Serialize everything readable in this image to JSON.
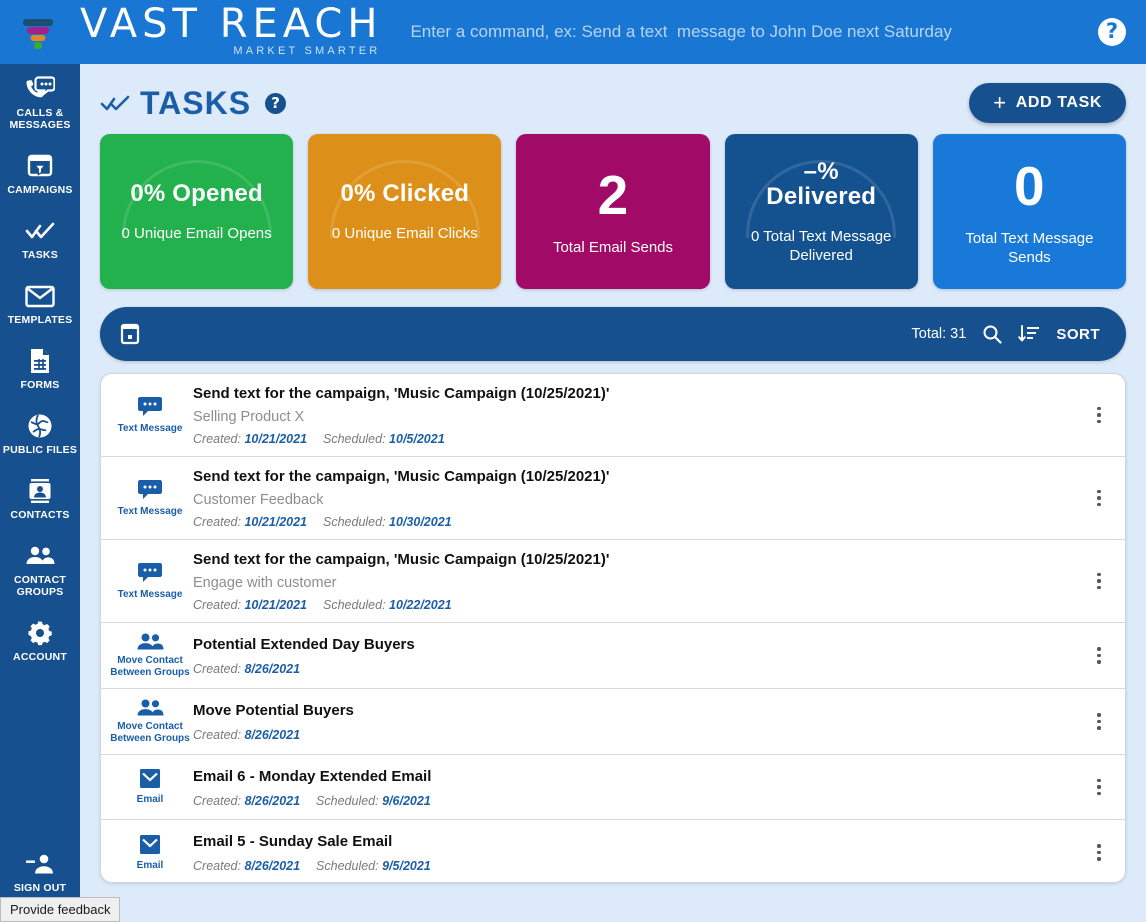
{
  "header": {
    "brand_name": "VAST REACH",
    "brand_tagline": "MARKET SMARTER",
    "command_placeholder": "Enter a command, ex: Send a text  message to John Doe next Saturday",
    "command_value": "",
    "help_glyph": "?"
  },
  "sidebar": {
    "items": [
      {
        "icon": "calls-messages-icon",
        "label": "CALLS &\nMESSAGES"
      },
      {
        "icon": "campaigns-icon",
        "label": "CAMPAIGNS"
      },
      {
        "icon": "tasks-icon",
        "label": "TASKS"
      },
      {
        "icon": "templates-icon",
        "label": "TEMPLATES"
      },
      {
        "icon": "forms-icon",
        "label": "FORMS"
      },
      {
        "icon": "public-files-icon",
        "label": "PUBLIC\nFILES"
      },
      {
        "icon": "contacts-icon",
        "label": "CONTACTS"
      },
      {
        "icon": "contact-groups-icon",
        "label": "CONTACT\nGROUPS"
      },
      {
        "icon": "account-icon",
        "label": "ACCOUNT"
      }
    ],
    "signout": {
      "icon": "sign-out-icon",
      "label": "SIGN OUT"
    }
  },
  "page": {
    "title": "TASKS",
    "help_glyph": "?",
    "add_task_label": "ADD TASK",
    "add_task_plus": "+"
  },
  "cards": [
    {
      "main": "0% Opened",
      "sub": "0 Unique Email Opens",
      "color": "#22b14c",
      "gauge": true,
      "big": false
    },
    {
      "main": "0% Clicked",
      "sub": "0 Unique Email Clicks",
      "color": "#dd9019",
      "gauge": true,
      "big": false
    },
    {
      "main": "2",
      "sub": "Total Email Sends",
      "color": "#a10a66",
      "gauge": false,
      "big": true
    },
    {
      "main": "–%\nDelivered",
      "sub": "0 Total Text Message Delivered",
      "color": "#13518f",
      "gauge": true,
      "big": false
    },
    {
      "main": "0",
      "sub": "Total Text Message Sends",
      "color": "#1879d8",
      "gauge": false,
      "big": true
    }
  ],
  "filterbar": {
    "calendar_icon": "calendar-icon",
    "total_label": "Total: 31",
    "search_icon": "search-icon",
    "sort_icon": "sort-descending-icon",
    "sort_label": "SORT"
  },
  "tasks": [
    {
      "type_icon": "text-message-icon",
      "type_label": "Text Message",
      "title": "Send text for the campaign, 'Music Campaign (10/25/2021)'",
      "desc": "Selling Product X",
      "created_label": "Created:",
      "created_value": "10/21/2021",
      "scheduled_label": "Scheduled:",
      "scheduled_value": "10/5/2021"
    },
    {
      "type_icon": "text-message-icon",
      "type_label": "Text Message",
      "title": "Send text for the campaign, 'Music Campaign (10/25/2021)'",
      "desc": "Customer Feedback",
      "created_label": "Created:",
      "created_value": "10/21/2021",
      "scheduled_label": "Scheduled:",
      "scheduled_value": "10/30/2021"
    },
    {
      "type_icon": "text-message-icon",
      "type_label": "Text Message",
      "title": "Send text for the campaign, 'Music Campaign (10/25/2021)'",
      "desc": "Engage with customer",
      "created_label": "Created:",
      "created_value": "10/21/2021",
      "scheduled_label": "Scheduled:",
      "scheduled_value": "10/22/2021"
    },
    {
      "type_icon": "move-contact-icon",
      "type_label": "Move Contact\nBetween Groups",
      "title": "Potential Extended Day Buyers",
      "desc": "",
      "created_label": "Created:",
      "created_value": "8/26/2021",
      "scheduled_label": "",
      "scheduled_value": ""
    },
    {
      "type_icon": "move-contact-icon",
      "type_label": "Move Contact\nBetween Groups",
      "title": "Move Potential Buyers",
      "desc": "",
      "created_label": "Created:",
      "created_value": "8/26/2021",
      "scheduled_label": "",
      "scheduled_value": ""
    },
    {
      "type_icon": "email-icon",
      "type_label": "Email",
      "title": "Email 6 - Monday Extended Email",
      "desc": "",
      "created_label": "Created:",
      "created_value": "8/26/2021",
      "scheduled_label": "Scheduled:",
      "scheduled_value": "9/6/2021"
    },
    {
      "type_icon": "email-icon",
      "type_label": "Email",
      "title": "Email 5 - Sunday Sale Email",
      "desc": "",
      "created_label": "Created:",
      "created_value": "8/26/2021",
      "scheduled_label": "Scheduled:",
      "scheduled_value": "9/5/2021"
    }
  ],
  "feedback": {
    "label": "Provide feedback"
  },
  "colors": {
    "brand_blue": "#1976d2",
    "sidebar_blue": "#17508f",
    "page_bg": "#dceafa",
    "title_blue": "#1b5ea8",
    "green": "#22b14c",
    "orange": "#dd9019",
    "magenta": "#a10a66",
    "navy": "#13518f",
    "blue": "#1879d8"
  }
}
